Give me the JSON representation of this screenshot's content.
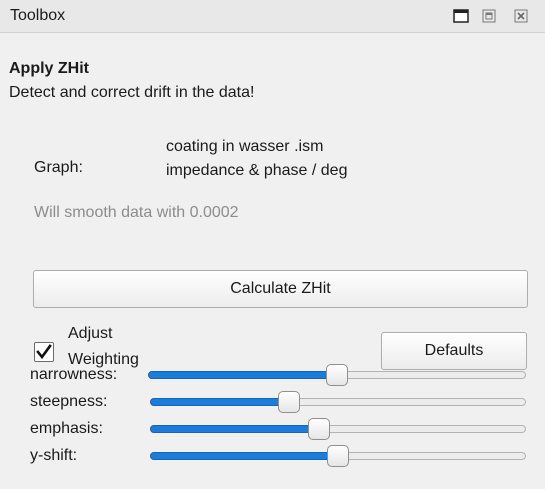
{
  "window": {
    "title": "Toolbox"
  },
  "heading": "Apply ZHit",
  "description": "Detect and correct drift in the data!",
  "graph": {
    "label": "Graph:",
    "line1": "coating in wasser .ism",
    "line2": "impedance & phase / deg"
  },
  "smooth_text": "Will smooth data with 0.0002",
  "calculate_label": "Calculate ZHit",
  "adjust": {
    "label_line1": "Adjust",
    "label_line2": "Weighting",
    "checked": true
  },
  "defaults_label": "Defaults",
  "sliders": [
    {
      "label": "narrowness:",
      "value": 0.5
    },
    {
      "label": "steepness:",
      "value": 0.37
    },
    {
      "label": "emphasis:",
      "value": 0.45
    },
    {
      "label": "y-shift:",
      "value": 0.5
    }
  ],
  "colors": {
    "accent": "#1c7cd9",
    "muted_text": "#8c8c8c"
  }
}
